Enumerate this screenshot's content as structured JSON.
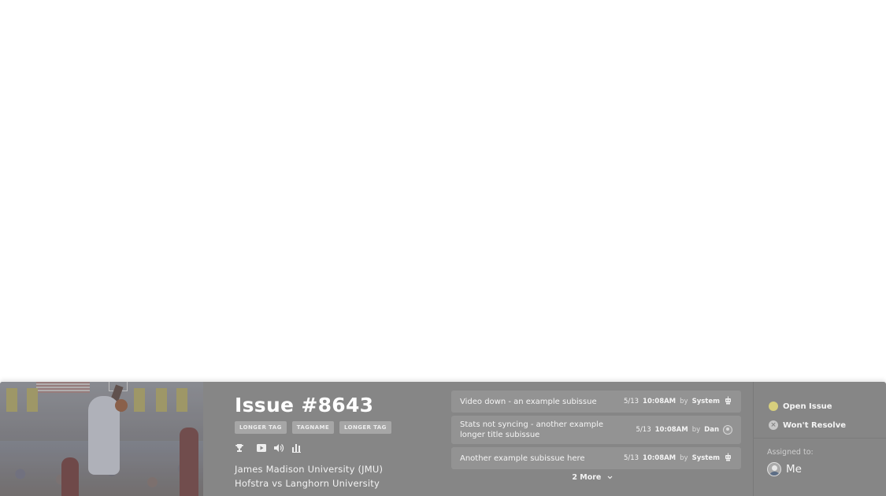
{
  "issue": {
    "title": "Issue #8643",
    "tags": [
      "LONGER TAG",
      "TAGNAME",
      "LONGER TAG"
    ],
    "icons": [
      "trophy-icon",
      "video-icon",
      "volume-icon",
      "stats-icon"
    ],
    "team_line_1": "James Madison University (JMU)",
    "team_line_2": "Hofstra vs Langhorn University"
  },
  "subissues": [
    {
      "description": "Video down - an example subissue",
      "date": "5/13",
      "time": "10:08AM",
      "by": "by",
      "user": "System",
      "user_icon": "robot-icon"
    },
    {
      "description": "Stats not syncing - another example longer title subissue",
      "date": "5/13",
      "time": "10:08AM",
      "by": "by",
      "user": "Dan",
      "user_icon": "avatar"
    },
    {
      "description": "Another example subissue here",
      "date": "5/13",
      "time": "10:08AM",
      "by": "by",
      "user": "System",
      "user_icon": "robot-icon"
    }
  ],
  "more_label": "2 More",
  "status": {
    "open_label": "Open Issue",
    "open_color": "#d7cf7d",
    "wont_resolve_label": "Won't Resolve",
    "assigned_label": "Assigned to:",
    "assignee": "Me"
  },
  "colors": {
    "card_bg": "#868686",
    "subissue_bg": "#939393",
    "tag_bg": "#a6a6a6"
  }
}
